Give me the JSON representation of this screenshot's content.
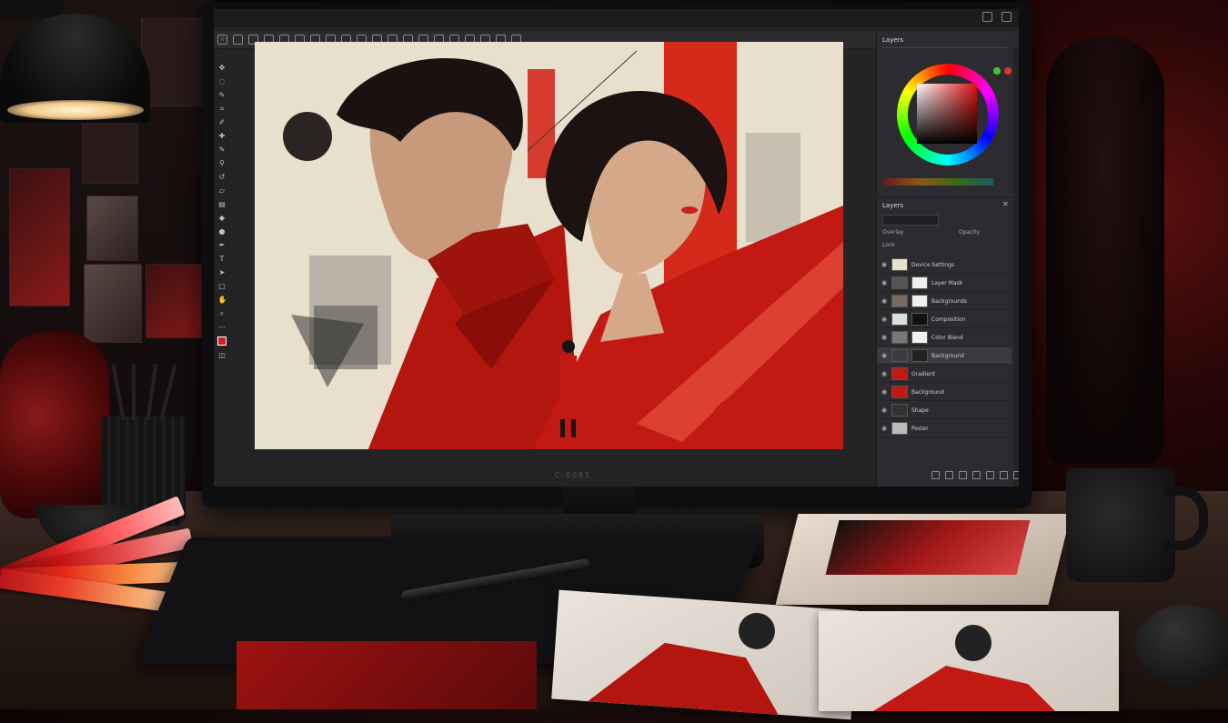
{
  "app": {
    "doc_title": "",
    "brand_label": "C·0081",
    "toolbar_icons": [
      "move-icon",
      "lasso-icon",
      "quick-select-icon",
      "crop-icon",
      "eyedropper-icon",
      "healing-icon",
      "brush-icon",
      "stamp-icon",
      "history-brush-icon",
      "eraser-icon",
      "gradient-icon",
      "blur-icon",
      "dodge-icon",
      "pen-icon",
      "type-icon",
      "path-select-icon",
      "shape-icon",
      "hand-icon",
      "zoom-icon",
      "more-icon"
    ],
    "colors": {
      "accent_red": "#d32020",
      "panel_bg": "#2c2c30",
      "canvas_bg": "#e8ddcb"
    }
  },
  "color_panel": {
    "tab_label": "Layers"
  },
  "layers_panel": {
    "title": "Layers",
    "filter_label": "Opacity",
    "mode_label": "Overlay",
    "lock_label": "Lock",
    "layers": [
      {
        "name": "Device Settings"
      },
      {
        "name": "Layer Mask"
      },
      {
        "name": "Backgrounds"
      },
      {
        "name": "Composition"
      },
      {
        "name": "Color Blend"
      },
      {
        "name": "Background"
      },
      {
        "name": "Gradient"
      },
      {
        "name": "Background"
      },
      {
        "name": "Shape"
      },
      {
        "name": "Poster"
      }
    ]
  }
}
